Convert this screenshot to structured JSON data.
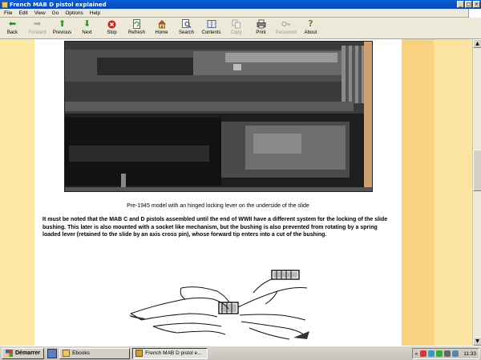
{
  "window": {
    "title": "French MAB D pistol explained"
  },
  "menubar": {
    "items": [
      "File",
      "Edit",
      "View",
      "Go",
      "Options",
      "Help"
    ]
  },
  "toolbar": {
    "buttons": [
      {
        "label": "Back",
        "icon": "arrow-left-icon",
        "enabled": true,
        "color": "#2a8a2a"
      },
      {
        "label": "Forward",
        "icon": "arrow-right-icon",
        "enabled": false,
        "color": "#a8a8a8"
      },
      {
        "label": "Previous",
        "icon": "arrow-up-icon",
        "enabled": true,
        "color": "#2a9a2a"
      },
      {
        "label": "Next",
        "icon": "arrow-down-icon",
        "enabled": true,
        "color": "#2a9a2a"
      },
      {
        "label": "Stop",
        "icon": "stop-icon",
        "enabled": true,
        "color": "#cc1f1f"
      },
      {
        "label": "Refresh",
        "icon": "refresh-icon",
        "enabled": true,
        "color": "#3a8a3a"
      },
      {
        "label": "Home",
        "icon": "home-icon",
        "enabled": true,
        "color": "#a87830"
      },
      {
        "label": "Search",
        "icon": "search-icon",
        "enabled": true,
        "color": "#3a5a8a"
      },
      {
        "label": "Contents",
        "icon": "book-icon",
        "enabled": true,
        "color": "#5a6a8a"
      },
      {
        "label": "Copy",
        "icon": "copy-icon",
        "enabled": false,
        "color": "#a8a8a8"
      },
      {
        "label": "Print",
        "icon": "printer-icon",
        "enabled": true,
        "color": "#555555"
      },
      {
        "label": "Password",
        "icon": "key-icon",
        "enabled": false,
        "color": "#a8a8a8"
      },
      {
        "label": "About",
        "icon": "question-icon",
        "enabled": true,
        "color": "#6a8a2a"
      }
    ]
  },
  "page": {
    "caption": "Pre-1945 model with an hinged locking lever on the underside of the slide",
    "paragraph": "It must be noted that the MAB C and D pistols assembled until the end of WWII have a different system for the locking of the slide bushing. This later is also mounted with a socket like mechanism, but the bushing is also prevented from rotating by a spring loaded lever (retained to the slide by an axis cross pin), whose forward tip enters into a cut of the bushing."
  },
  "taskbar": {
    "start_label": "Démarrer",
    "tasks": [
      {
        "label": "Ebooks",
        "active": false
      },
      {
        "label": "French MAB D pistol e...",
        "active": true
      }
    ],
    "clock": "11:33",
    "chevron": "«"
  },
  "colors": {
    "titlebar": "#0a5fd8",
    "page_bg": "#ffffff",
    "margin_band": "#f7d892"
  }
}
